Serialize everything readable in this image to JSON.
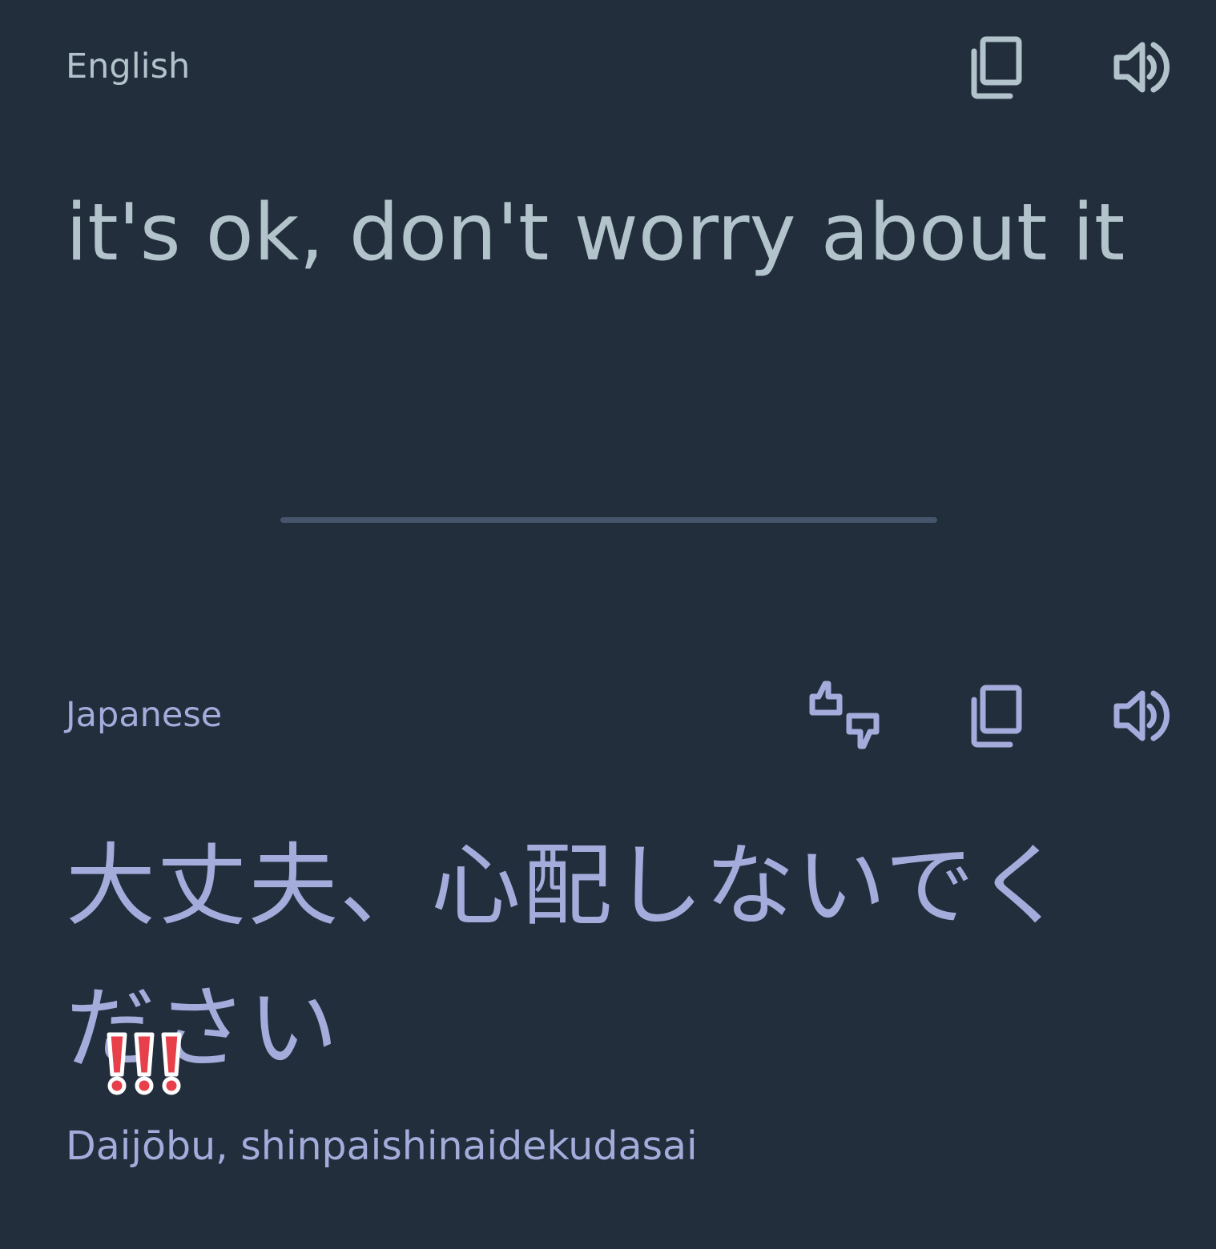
{
  "colors": {
    "background": "#222e3b",
    "source_text": "#b3c3cb",
    "target_text": "#a3acdb",
    "divider": "#47556a",
    "emoji_red": "#e8404a"
  },
  "source": {
    "language": "English",
    "text": "it's ok, don't worry about it",
    "icons": [
      "copy-icon",
      "speaker-icon"
    ]
  },
  "target": {
    "language": "Japanese",
    "text": "大丈夫、心配しないでください",
    "romanization": "Daijōbu, shinpaishinaidekudasai",
    "icons": [
      "rate-translation-icon",
      "copy-icon",
      "speaker-icon"
    ]
  },
  "overlay": {
    "emoji": "triple-exclamation-mark"
  }
}
